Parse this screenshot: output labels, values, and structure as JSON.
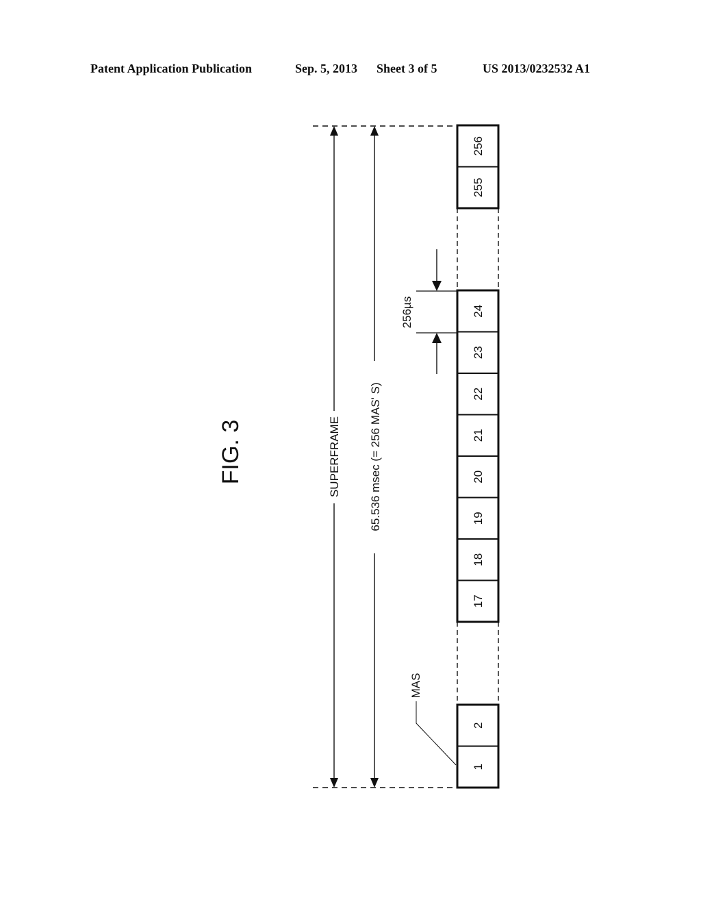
{
  "header": {
    "publication_label": "Patent Application Publication",
    "date": "Sep. 5, 2013",
    "sheet": "Sheet 3 of 5",
    "patent_number": "US 2013/0232532 A1"
  },
  "figure": {
    "title": "FIG. 3",
    "superframe_label": "SUPERFRAME",
    "duration_label": "65.536 msec (= 256 MAS' S)",
    "mas_duration_label": "256µs",
    "mas_callout_label": "MAS",
    "slot_groups": [
      {
        "slots": [
          "1",
          "2"
        ]
      },
      {
        "slots": [
          "17",
          "18",
          "19",
          "20",
          "21",
          "22",
          "23",
          "24"
        ]
      },
      {
        "slots": [
          "255",
          "256"
        ]
      }
    ]
  }
}
